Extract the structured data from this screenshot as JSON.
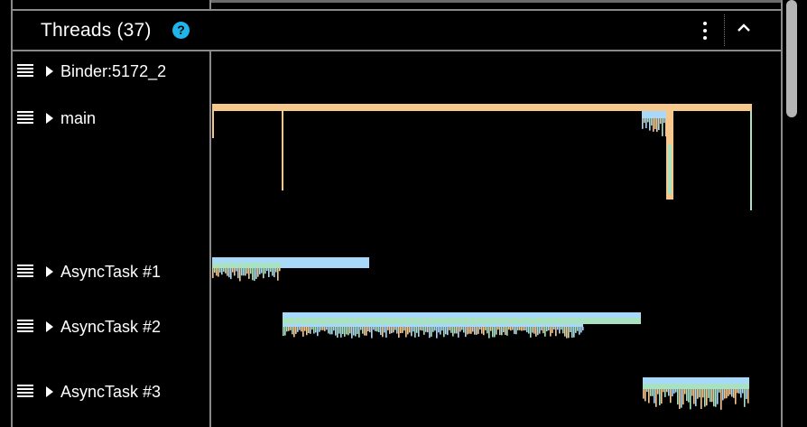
{
  "panel": {
    "title": "Threads (37)",
    "help_icon": "question-circle-icon",
    "menu_icon": "more-vertical-icon",
    "collapse_icon": "chevron-up-icon"
  },
  "threads": [
    {
      "label": "Binder:5172_2"
    },
    {
      "label": "main"
    },
    {
      "label": "AsyncTask #1"
    },
    {
      "label": "AsyncTask #2"
    },
    {
      "label": "AsyncTask #3"
    }
  ],
  "colors": {
    "background": "#000000",
    "help_accent": "#1fb4ea",
    "slice_orange": "#f6c88e",
    "slice_blue": "#a9d9fa",
    "slice_green": "#a8e2c0"
  }
}
